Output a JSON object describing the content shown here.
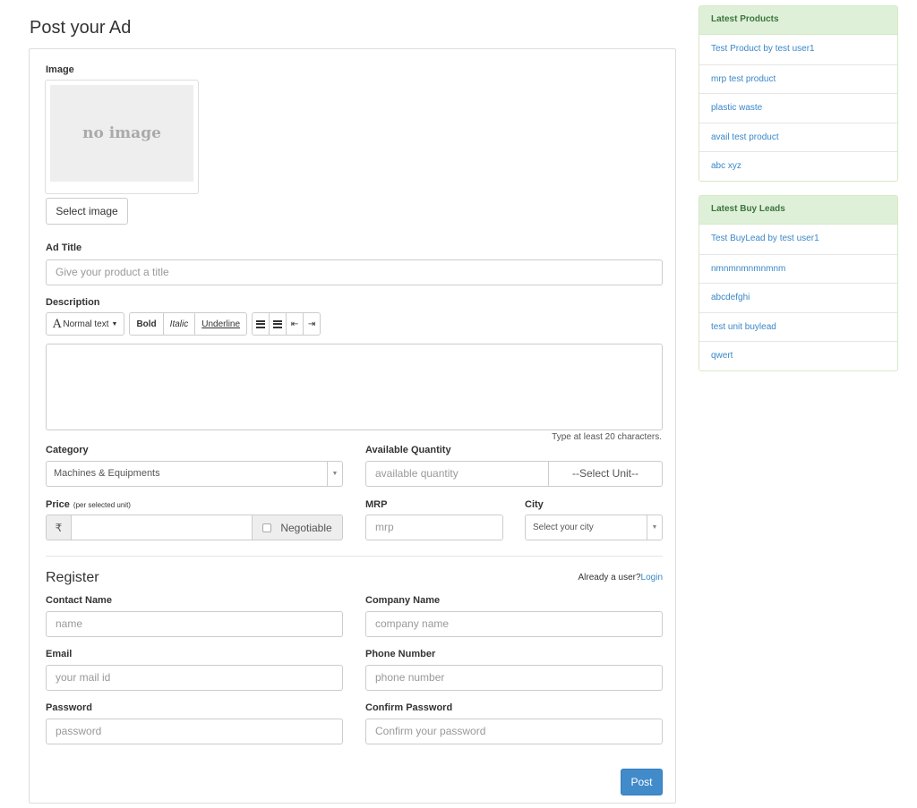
{
  "page": {
    "title": "Post your Ad"
  },
  "image_section": {
    "label": "Image",
    "placeholder_text": "no image",
    "select_button": "Select image"
  },
  "ad_title": {
    "label": "Ad Title",
    "placeholder": "Give your product a title"
  },
  "description": {
    "label": "Description",
    "toolbar": {
      "font_style": "Normal text",
      "font_style_icon": "A",
      "bold": "Bold",
      "italic": "Italic",
      "underline": "Underline",
      "icons": [
        "unordered-list-icon",
        "ordered-list-icon",
        "outdent-icon",
        "indent-icon"
      ]
    },
    "hint": "Type at least 20 characters."
  },
  "category": {
    "label": "Category",
    "value": "Machines & Equipments"
  },
  "available_quantity": {
    "label": "Available Quantity",
    "placeholder": "available quantity",
    "unit_select": "--Select Unit--"
  },
  "price": {
    "label": "Price",
    "sub_label": "(per selected unit)",
    "currency_symbol": "₹",
    "negotiable_label": "Negotiable"
  },
  "mrp": {
    "label": "MRP",
    "placeholder": "mrp"
  },
  "city": {
    "label": "City",
    "value": "Select your city"
  },
  "register": {
    "title": "Register",
    "already_user": "Already a user?",
    "login_link": "Login",
    "contact_name": {
      "label": "Contact Name",
      "placeholder": "name"
    },
    "company_name": {
      "label": "Company Name",
      "placeholder": "company name"
    },
    "email": {
      "label": "Email",
      "placeholder": "your mail id"
    },
    "phone": {
      "label": "Phone Number",
      "placeholder": "phone number"
    },
    "password": {
      "label": "Password",
      "placeholder": "password"
    },
    "confirm_password": {
      "label": "Confirm Password",
      "placeholder": "Confirm your password"
    }
  },
  "post_button": "Post",
  "sidebar": {
    "latest_products": {
      "title": "Latest Products",
      "items": [
        "Test Product by test user1",
        "mrp test product",
        "plastic waste",
        "avail test product",
        "abc xyz"
      ]
    },
    "latest_buy_leads": {
      "title": "Latest Buy Leads",
      "items": [
        "Test BuyLead by test user1",
        "nmnmnmnmnmnm",
        "abcdefghi",
        "test unit buylead",
        "qwert"
      ]
    }
  },
  "colors": {
    "accent": "#428bca",
    "link": "#3a87c8",
    "panel_header_bg": "#dff0d8",
    "panel_header_text": "#3c763d"
  }
}
